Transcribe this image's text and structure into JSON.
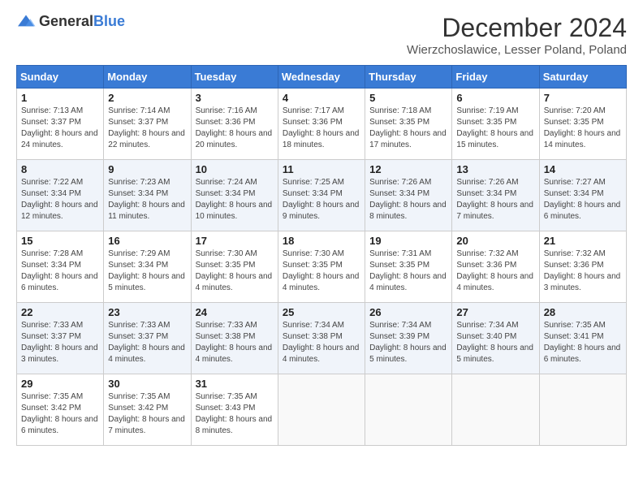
{
  "header": {
    "logo_general": "General",
    "logo_blue": "Blue",
    "month_title": "December 2024",
    "subtitle": "Wierzchoslawice, Lesser Poland, Poland"
  },
  "calendar": {
    "days_of_week": [
      "Sunday",
      "Monday",
      "Tuesday",
      "Wednesday",
      "Thursday",
      "Friday",
      "Saturday"
    ],
    "weeks": [
      [
        {
          "day": "1",
          "sunrise": "7:13 AM",
          "sunset": "3:37 PM",
          "daylight": "8 hours and 24 minutes."
        },
        {
          "day": "2",
          "sunrise": "7:14 AM",
          "sunset": "3:37 PM",
          "daylight": "8 hours and 22 minutes."
        },
        {
          "day": "3",
          "sunrise": "7:16 AM",
          "sunset": "3:36 PM",
          "daylight": "8 hours and 20 minutes."
        },
        {
          "day": "4",
          "sunrise": "7:17 AM",
          "sunset": "3:36 PM",
          "daylight": "8 hours and 18 minutes."
        },
        {
          "day": "5",
          "sunrise": "7:18 AM",
          "sunset": "3:35 PM",
          "daylight": "8 hours and 17 minutes."
        },
        {
          "day": "6",
          "sunrise": "7:19 AM",
          "sunset": "3:35 PM",
          "daylight": "8 hours and 15 minutes."
        },
        {
          "day": "7",
          "sunrise": "7:20 AM",
          "sunset": "3:35 PM",
          "daylight": "8 hours and 14 minutes."
        }
      ],
      [
        {
          "day": "8",
          "sunrise": "7:22 AM",
          "sunset": "3:34 PM",
          "daylight": "8 hours and 12 minutes."
        },
        {
          "day": "9",
          "sunrise": "7:23 AM",
          "sunset": "3:34 PM",
          "daylight": "8 hours and 11 minutes."
        },
        {
          "day": "10",
          "sunrise": "7:24 AM",
          "sunset": "3:34 PM",
          "daylight": "8 hours and 10 minutes."
        },
        {
          "day": "11",
          "sunrise": "7:25 AM",
          "sunset": "3:34 PM",
          "daylight": "8 hours and 9 minutes."
        },
        {
          "day": "12",
          "sunrise": "7:26 AM",
          "sunset": "3:34 PM",
          "daylight": "8 hours and 8 minutes."
        },
        {
          "day": "13",
          "sunrise": "7:26 AM",
          "sunset": "3:34 PM",
          "daylight": "8 hours and 7 minutes."
        },
        {
          "day": "14",
          "sunrise": "7:27 AM",
          "sunset": "3:34 PM",
          "daylight": "8 hours and 6 minutes."
        }
      ],
      [
        {
          "day": "15",
          "sunrise": "7:28 AM",
          "sunset": "3:34 PM",
          "daylight": "8 hours and 6 minutes."
        },
        {
          "day": "16",
          "sunrise": "7:29 AM",
          "sunset": "3:34 PM",
          "daylight": "8 hours and 5 minutes."
        },
        {
          "day": "17",
          "sunrise": "7:30 AM",
          "sunset": "3:35 PM",
          "daylight": "8 hours and 4 minutes."
        },
        {
          "day": "18",
          "sunrise": "7:30 AM",
          "sunset": "3:35 PM",
          "daylight": "8 hours and 4 minutes."
        },
        {
          "day": "19",
          "sunrise": "7:31 AM",
          "sunset": "3:35 PM",
          "daylight": "8 hours and 4 minutes."
        },
        {
          "day": "20",
          "sunrise": "7:32 AM",
          "sunset": "3:36 PM",
          "daylight": "8 hours and 4 minutes."
        },
        {
          "day": "21",
          "sunrise": "7:32 AM",
          "sunset": "3:36 PM",
          "daylight": "8 hours and 3 minutes."
        }
      ],
      [
        {
          "day": "22",
          "sunrise": "7:33 AM",
          "sunset": "3:37 PM",
          "daylight": "8 hours and 3 minutes."
        },
        {
          "day": "23",
          "sunrise": "7:33 AM",
          "sunset": "3:37 PM",
          "daylight": "8 hours and 4 minutes."
        },
        {
          "day": "24",
          "sunrise": "7:33 AM",
          "sunset": "3:38 PM",
          "daylight": "8 hours and 4 minutes."
        },
        {
          "day": "25",
          "sunrise": "7:34 AM",
          "sunset": "3:38 PM",
          "daylight": "8 hours and 4 minutes."
        },
        {
          "day": "26",
          "sunrise": "7:34 AM",
          "sunset": "3:39 PM",
          "daylight": "8 hours and 5 minutes."
        },
        {
          "day": "27",
          "sunrise": "7:34 AM",
          "sunset": "3:40 PM",
          "daylight": "8 hours and 5 minutes."
        },
        {
          "day": "28",
          "sunrise": "7:35 AM",
          "sunset": "3:41 PM",
          "daylight": "8 hours and 6 minutes."
        }
      ],
      [
        {
          "day": "29",
          "sunrise": "7:35 AM",
          "sunset": "3:42 PM",
          "daylight": "8 hours and 6 minutes."
        },
        {
          "day": "30",
          "sunrise": "7:35 AM",
          "sunset": "3:42 PM",
          "daylight": "8 hours and 7 minutes."
        },
        {
          "day": "31",
          "sunrise": "7:35 AM",
          "sunset": "3:43 PM",
          "daylight": "8 hours and 8 minutes."
        },
        null,
        null,
        null,
        null
      ]
    ],
    "sunrise_label": "Sunrise:",
    "sunset_label": "Sunset:",
    "daylight_label": "Daylight:"
  }
}
